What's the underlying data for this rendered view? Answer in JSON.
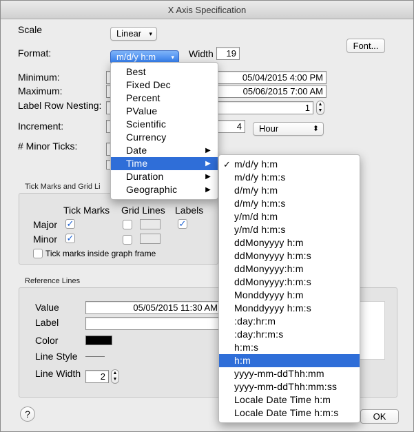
{
  "window": {
    "title": "X Axis Specification"
  },
  "scale": {
    "label": "Scale",
    "value": "Linear"
  },
  "format": {
    "label": "Format:",
    "value": "m/d/y h:m",
    "width_label": "Width",
    "width_value": "19",
    "font_button": "Font..."
  },
  "minimum": {
    "label": "Minimum:",
    "value": "05/04/2015 4:00 PM"
  },
  "maximum": {
    "label": "Maximum:",
    "value": "05/06/2015 7:00 AM"
  },
  "label_row_nesting": {
    "label": "Label Row Nesting:",
    "value": "1"
  },
  "increment": {
    "label": "Increment:",
    "value": "4",
    "unit": "Hour"
  },
  "minor_ticks": {
    "label": "# Minor Ticks:"
  },
  "tick_group": {
    "title": "Tick Marks and Grid Li",
    "col_tick_marks": "Tick Marks",
    "col_grid_lines": "Grid Lines",
    "col_labels": "Labels",
    "row_major": "Major",
    "row_minor": "Minor",
    "inside_frame": "Tick marks inside graph frame",
    "checkmark": "✓"
  },
  "ref_group": {
    "title": "Reference Lines",
    "value_label": "Value",
    "value": "05/05/2015 11:30 AM",
    "label_label": "Label",
    "color_label": "Color",
    "color_value": "#000000",
    "line_style_label": "Line Style",
    "line_width_label": "Line Width",
    "line_width_value": "2"
  },
  "buttons": {
    "help": "?",
    "ok": "OK"
  },
  "format_menu": {
    "items": [
      {
        "label": "Best",
        "submenu": false
      },
      {
        "label": "Fixed Dec",
        "submenu": false
      },
      {
        "label": "Percent",
        "submenu": false
      },
      {
        "label": "PValue",
        "submenu": false
      },
      {
        "label": "Scientific",
        "submenu": false
      },
      {
        "label": "Currency",
        "submenu": false
      },
      {
        "label": "Date",
        "submenu": true
      },
      {
        "label": "Time",
        "submenu": true,
        "highlighted": true
      },
      {
        "label": "Duration",
        "submenu": true
      },
      {
        "label": "Geographic",
        "submenu": true
      }
    ],
    "submenu_arrow": "▶"
  },
  "time_menu": {
    "checkmark": "✓",
    "items": [
      {
        "label": "m/d/y h:m",
        "checked": true
      },
      {
        "label": "m/d/y h:m:s"
      },
      {
        "label": "d/m/y h:m"
      },
      {
        "label": "d/m/y h:m:s"
      },
      {
        "label": "y/m/d h:m"
      },
      {
        "label": "y/m/d h:m:s"
      },
      {
        "label": "ddMonyyyy h:m"
      },
      {
        "label": "ddMonyyyy h:m:s"
      },
      {
        "label": "ddMonyyyy:h:m"
      },
      {
        "label": "ddMonyyyy:h:m:s"
      },
      {
        "label": "Monddyyyy h:m"
      },
      {
        "label": "Monddyyyy h:m:s"
      },
      {
        "label": ":day:hr:m"
      },
      {
        "label": ":day:hr:m:s"
      },
      {
        "label": "h:m:s"
      },
      {
        "label": "h:m",
        "highlighted": true
      },
      {
        "label": "yyyy-mm-ddThh:mm"
      },
      {
        "label": "yyyy-mm-ddThh:mm:ss"
      },
      {
        "label": "Locale Date Time h:m"
      },
      {
        "label": "Locale Date Time h:m:s"
      }
    ]
  },
  "icons": {
    "popup_arrow": "▾",
    "stepper_up": "▲",
    "stepper_down": "▼",
    "updown": "⬍"
  }
}
